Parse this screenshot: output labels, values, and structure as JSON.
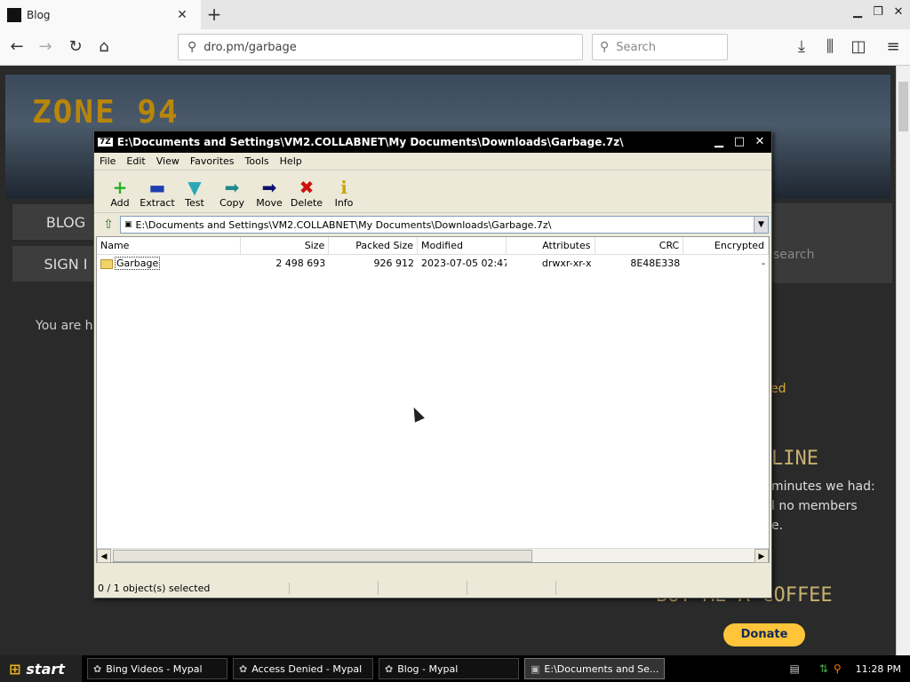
{
  "browser": {
    "tab_title": "Blog",
    "url": "dro.pm/garbage",
    "search_placeholder": "Search"
  },
  "page": {
    "logo": "ZONE 94",
    "sidebar": [
      "BLOG",
      "SIGN I"
    ],
    "you_text": "You are h",
    "search_ph": "search",
    "ed": "ed",
    "line_title": "LINE",
    "right_lines": [
      "minutes we had:",
      "l no members",
      "e."
    ],
    "coffee": "BUY ME A COFFEE",
    "donate": "Donate"
  },
  "zip": {
    "title": "E:\\Documents and Settings\\VM2.COLLABNET\\My Documents\\Downloads\\Garbage.7z\\",
    "app_icon": "7Z",
    "menu": [
      "File",
      "Edit",
      "View",
      "Favorites",
      "Tools",
      "Help"
    ],
    "toolbar": [
      {
        "label": "Add",
        "icon": "+",
        "color": "#22b322"
      },
      {
        "label": "Extract",
        "icon": "▬",
        "color": "#1f3fae"
      },
      {
        "label": "Test",
        "icon": "▼",
        "color": "#2aa8b8"
      },
      {
        "label": "Copy",
        "icon": "➡",
        "color": "#1e8a8a"
      },
      {
        "label": "Move",
        "icon": "➡",
        "color": "#10106e"
      },
      {
        "label": "Delete",
        "icon": "✖",
        "color": "#cc1111"
      },
      {
        "label": "Info",
        "icon": "i",
        "color": "#c8a800"
      }
    ],
    "address": "E:\\Documents and Settings\\VM2.COLLABNET\\My Documents\\Downloads\\Garbage.7z\\",
    "columns": [
      "Name",
      "Size",
      "Packed Size",
      "Modified",
      "Attributes",
      "CRC",
      "Encrypted"
    ],
    "rows": [
      {
        "name": "Garbage",
        "size": "2 498 693",
        "packed": "926 912",
        "modified": "2023-07-05 02:47",
        "attributes": "drwxr-xr-x",
        "crc": "8E48E338",
        "encrypted": "-"
      }
    ],
    "status": "0 / 1 object(s) selected"
  },
  "taskbar": {
    "start": "start",
    "tasks": [
      "Bing Videos - Mypal",
      "Access Denied - Mypal",
      "Blog - Mypal",
      "E:\\Documents and Se..."
    ],
    "clock": "11:28 PM"
  }
}
